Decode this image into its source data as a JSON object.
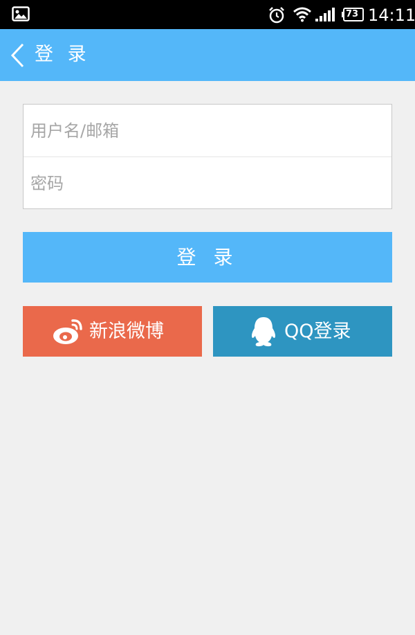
{
  "status_bar": {
    "battery": "73",
    "time": "14:11",
    "icons": [
      "picture-icon",
      "alarm-icon",
      "wifi-icon",
      "signal-icon",
      "battery-icon"
    ]
  },
  "header": {
    "title": "登 录",
    "back_icon": "chevron-left-icon",
    "background": "#54b7f9"
  },
  "form": {
    "username_placeholder": "用户名/邮箱",
    "username_value": "",
    "password_placeholder": "密码",
    "password_value": ""
  },
  "login_button": {
    "label": "登 录",
    "color": "#54b7f9"
  },
  "social": {
    "weibo": {
      "label": "新浪微博",
      "icon": "weibo-icon",
      "color": "#ea694b"
    },
    "qq": {
      "label": "QQ登录",
      "icon": "qq-penguin-icon",
      "color": "#2e95c1"
    }
  }
}
